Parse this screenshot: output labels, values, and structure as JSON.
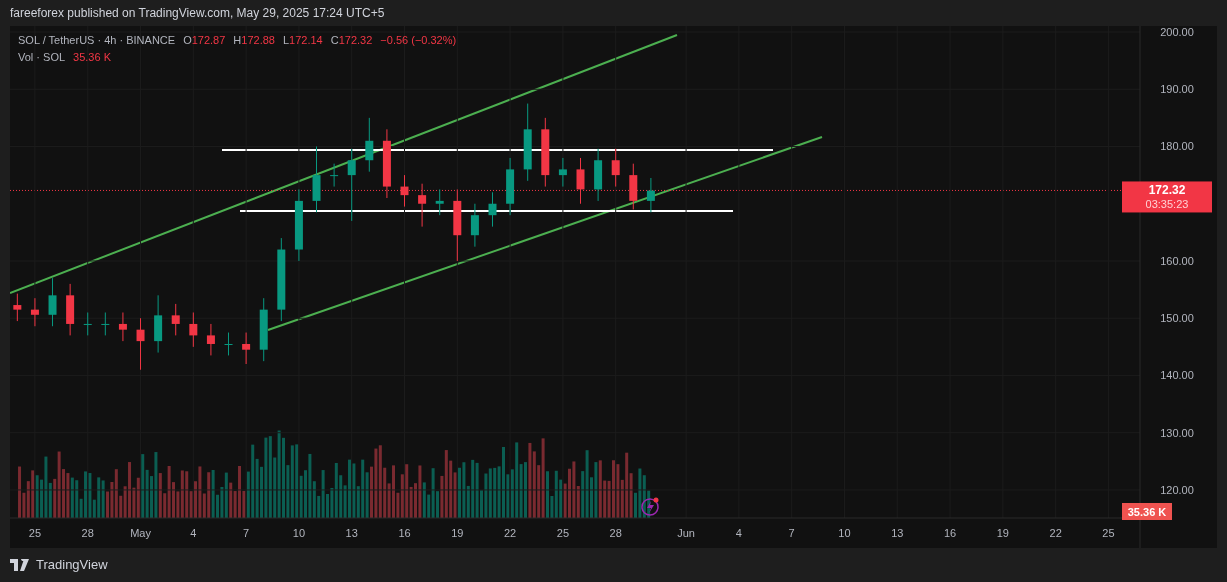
{
  "header": {
    "text": "fareeforex published on TradingView.com, May 29, 2025 17:24 UTC+5"
  },
  "legend": {
    "symbol": "SOL / TetherUS · 4h · BINANCE",
    "ohlc": [
      {
        "label": "O",
        "value": "172.87"
      },
      {
        "label": "H",
        "value": "172.88"
      },
      {
        "label": "L",
        "value": "172.14"
      },
      {
        "label": "C",
        "value": "172.32"
      }
    ],
    "change": "−0.56 (−0.32%)",
    "volume_label": "Vol · SOL",
    "volume_value": "35.36 K"
  },
  "chart": {
    "last_price": "172.32",
    "countdown": "03:35:23",
    "volume_badge": "35.36 K",
    "chart_data": {
      "type": "candlestick",
      "xlim": [
        "2025-04-23T14:00",
        "2025-06-26T19:00"
      ],
      "ylim": [
        115.1,
        201.05
      ],
      "grid": true,
      "x": [
        "2025-04-24",
        "2025-04-25",
        "2025-04-26",
        "2025-04-27",
        "2025-04-28",
        "2025-04-29",
        "2025-04-30",
        "2025-05-01",
        "2025-05-02",
        "2025-05-03",
        "2025-05-04",
        "2025-05-05",
        "2025-05-06",
        "2025-05-07",
        "2025-05-08",
        "2025-05-09",
        "2025-05-10",
        "2025-05-11",
        "2025-05-12",
        "2025-05-13",
        "2025-05-14",
        "2025-05-15",
        "2025-05-16",
        "2025-05-17",
        "2025-05-18",
        "2025-05-19",
        "2025-05-20",
        "2025-05-21",
        "2025-05-22",
        "2025-05-23",
        "2025-05-24",
        "2025-05-25",
        "2025-05-26",
        "2025-05-27",
        "2025-05-28",
        "2025-05-29",
        "2025-05-30"
      ],
      "ohlc": [
        [
          152.3,
          154.3,
          149.5,
          151.5
        ],
        [
          151.5,
          153.5,
          148.6,
          150.6
        ],
        [
          150.6,
          157,
          148.6,
          154
        ],
        [
          154,
          156,
          147,
          149
        ],
        [
          149,
          151,
          147,
          149
        ],
        [
          149,
          151,
          147,
          149
        ],
        [
          149,
          151,
          146,
          148
        ],
        [
          148,
          150,
          141,
          146
        ],
        [
          146,
          154,
          144,
          150.5
        ],
        [
          150.5,
          152.5,
          147,
          149
        ],
        [
          149,
          151,
          145,
          147
        ],
        [
          147,
          149,
          143.5,
          145.5
        ],
        [
          145.5,
          147.5,
          143.5,
          145.5
        ],
        [
          145.5,
          147.5,
          142,
          144.5
        ],
        [
          144.5,
          153.5,
          142.5,
          151.5
        ],
        [
          151.5,
          164,
          149.5,
          162
        ],
        [
          162,
          172.5,
          160,
          170.5
        ],
        [
          170.5,
          180,
          168.5,
          175
        ],
        [
          175,
          177,
          173,
          175
        ],
        [
          175,
          179.6,
          167,
          177.6
        ],
        [
          177.6,
          185,
          175.6,
          181
        ],
        [
          181,
          183,
          171,
          173
        ],
        [
          173,
          175,
          169.5,
          171.5
        ],
        [
          171.5,
          173.5,
          166,
          170
        ],
        [
          170,
          172.5,
          168,
          170.5
        ],
        [
          170.5,
          172.5,
          160,
          164.5
        ],
        [
          164.5,
          170,
          162.5,
          168
        ],
        [
          168,
          172,
          166,
          170
        ],
        [
          170,
          178,
          168,
          176
        ],
        [
          176,
          187.5,
          174,
          183
        ],
        [
          183,
          185,
          173,
          175
        ],
        [
          175,
          178,
          173,
          176
        ],
        [
          176,
          178,
          170,
          172.5
        ],
        [
          172.5,
          179.6,
          170.5,
          177.6
        ],
        [
          177.6,
          179.6,
          173,
          175
        ],
        [
          175,
          177,
          169,
          170.5
        ],
        [
          170.5,
          174.5,
          168.5,
          172.3
        ]
      ],
      "xticks": [
        {
          "value": "2025-04-25",
          "label": "25"
        },
        {
          "value": "2025-04-28",
          "label": "28"
        },
        {
          "value": "2025-05-01",
          "label": "May"
        },
        {
          "value": "2025-05-04",
          "label": "4"
        },
        {
          "value": "2025-05-07",
          "label": "7"
        },
        {
          "value": "2025-05-10",
          "label": "10"
        },
        {
          "value": "2025-05-13",
          "label": "13"
        },
        {
          "value": "2025-05-16",
          "label": "16"
        },
        {
          "value": "2025-05-19",
          "label": "19"
        },
        {
          "value": "2025-05-22",
          "label": "22"
        },
        {
          "value": "2025-05-25",
          "label": "25"
        },
        {
          "value": "2025-05-28",
          "label": "28"
        },
        {
          "value": "2025-06-01",
          "label": "Jun"
        },
        {
          "value": "2025-06-04",
          "label": "4"
        },
        {
          "value": "2025-06-07",
          "label": "7"
        },
        {
          "value": "2025-06-10",
          "label": "10"
        },
        {
          "value": "2025-06-13",
          "label": "13"
        },
        {
          "value": "2025-06-16",
          "label": "16"
        },
        {
          "value": "2025-06-19",
          "label": "19"
        },
        {
          "value": "2025-06-22",
          "label": "22"
        },
        {
          "value": "2025-06-25",
          "label": "25"
        }
      ],
      "yticks": [
        {
          "value": 120,
          "label": "120.00"
        },
        {
          "value": 130,
          "label": "130.00"
        },
        {
          "value": 140,
          "label": "140.00"
        },
        {
          "value": 150,
          "label": "150.00"
        },
        {
          "value": 160,
          "label": "160.00"
        },
        {
          "value": 180,
          "label": "180.00"
        },
        {
          "value": 190,
          "label": "190.00"
        },
        {
          "value": 200,
          "label": "200.00"
        }
      ]
    }
  },
  "footer": {
    "brand": "TradingView"
  }
}
